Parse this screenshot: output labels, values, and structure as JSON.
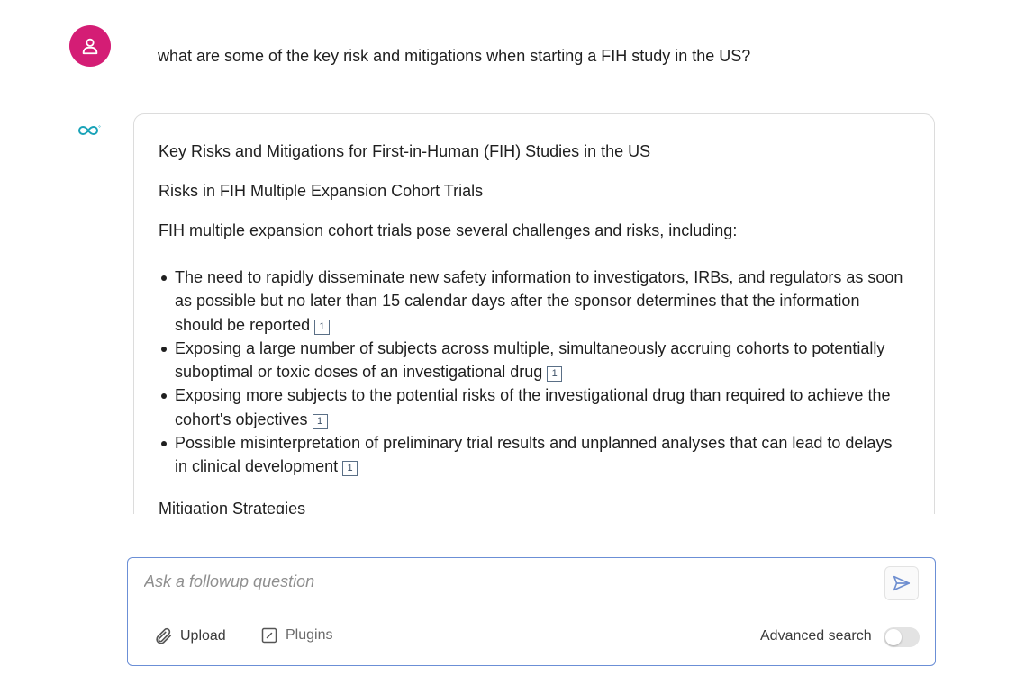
{
  "user_message": {
    "text": "what are some of the key risk and mitigations when starting a FIH study in the US?"
  },
  "answer": {
    "title": "Key Risks and Mitigations for First-in-Human (FIH) Studies in the US",
    "subtitle": "Risks in FIH Multiple Expansion Cohort Trials",
    "intro": "FIH multiple expansion cohort trials pose several challenges and risks, including:",
    "risks": [
      {
        "text": "The need to rapidly disseminate new safety information to investigators, IRBs, and regulators as soon as possible but no later than 15 calendar days after the sponsor determines that the information should be reported",
        "citation": "1"
      },
      {
        "text": "Exposing a large number of subjects across multiple, simultaneously accruing cohorts to potentially suboptimal or toxic doses of an investigational drug",
        "citation": "1"
      },
      {
        "text": "Exposing more subjects to the potential risks of the investigational drug than required to achieve the cohort's objectives",
        "citation": "1"
      },
      {
        "text": "Possible misinterpretation of preliminary trial results and unplanned analyses that can lead to delays in clinical development",
        "citation": "1"
      }
    ],
    "mitigation_heading": "Mitigation Strategies"
  },
  "followup": {
    "placeholder": "Ask a followup question",
    "upload_label": "Upload",
    "plugins_label": "Plugins",
    "advanced_search_label": "Advanced search",
    "advanced_search_enabled": false
  },
  "colors": {
    "avatar": "#d41d75",
    "logo": "#1aa3b8",
    "input_border": "#6b8fd6"
  },
  "icons": {
    "avatar": "user-icon",
    "assistant": "infinity-logo-icon",
    "send": "send-icon",
    "upload": "paperclip-icon",
    "plugins": "plugin-icon"
  }
}
